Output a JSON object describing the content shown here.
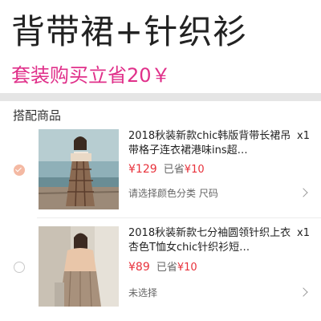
{
  "banner": {
    "title": "背带裙+针织衫",
    "subtitle": "套装购买立省20￥",
    "accent_color": "#e0308a"
  },
  "section": {
    "title": "搭配商品"
  },
  "items": [
    {
      "title": "2018秋装新款chic韩版背带长裙吊带格子连衣裙港味ins超…",
      "price": "¥129",
      "saved_label": "已省",
      "saved_value": "¥10",
      "spec": "请选择颜色分类 尺码",
      "qty": "x1",
      "selected": true,
      "thumb_icon": "plaid-dress-photo"
    },
    {
      "title": "2018秋装新款七分袖圆领针织上衣杏色T恤女chic针织衫短…",
      "price": "¥89",
      "saved_label": "已省",
      "saved_value": "¥10",
      "spec": "未选择",
      "qty": "x1",
      "selected": false,
      "thumb_icon": "knit-top-photo"
    }
  ],
  "colors": {
    "price": "#e8323c",
    "radio_checked": "#f4b9a3"
  }
}
